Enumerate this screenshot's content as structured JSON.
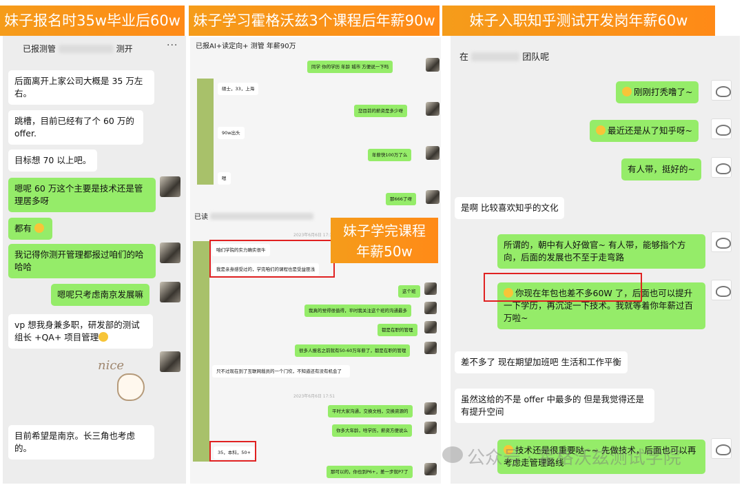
{
  "banners": {
    "left": "妹子报名时35w毕业后60w",
    "middle": "妹子学习霍格沃兹3个课程后年薪90w",
    "right": "妹子入职知乎测试开发岗年薪60w",
    "overlay": "妹子学完课程年薪50w"
  },
  "left_chat": {
    "title_prefix": "已报测管",
    "title_suffix": "测开",
    "menu": "···",
    "messages": [
      "后面离开上家公司大概是 35 万左右。",
      "跳槽，目前已经有了个 60 万的 offer.",
      "目标想 70 以上吧。",
      "嗯呢 60 万这个主要是技术还是管理居多呀",
      "都有",
      "我记得你测开管理都报过咱们的哈哈哈",
      "嗯呢只考虑南京发展嘛",
      "vp 想我身兼多职，研发部的测试组长 +QA+ 项目管理",
      "目前希望是南京。长三角也考虑的。"
    ],
    "sticker": "nice"
  },
  "mid_top_chat": {
    "title": "已报AI+读定向+ 测管 年薪90万",
    "messages": [
      "同学 你的学历  年龄  城市 方便说一下吗",
      "硕士，33，上海",
      "您目前的薪资是多少呀",
      "90w出头",
      "年薪快100万了么",
      "嗯",
      "那666了呀"
    ]
  },
  "mid_bottom_chat": {
    "title_prefix": "已读",
    "time1": "2023年6月6日 17:37",
    "time2": "2023年6月6日 17:51",
    "messages": [
      "咱们学院的实力确实很牛",
      "我是亲身感受过的，学完咱们的课程也是受益匪浅",
      "这个班",
      "我真的觉得很值得，平时我关注这个班的沟通最多",
      "都是在职的管理",
      "很多人报名之前就有50-60万年薪了，都是在职的管理",
      "只不过现在到了互联网裁员的一个门坎，不知道还有没有机会了",
      "平时大家沟通，交换文档，交换资源的",
      "你多大年龄，啥学历，薪资方便说么",
      "35，本科，50+",
      "那可以的，你也到P6+，差一步就P7了"
    ]
  },
  "right_chat": {
    "title_prefix": "在",
    "title_suffix": "团队呢",
    "messages": [
      "刚刚打秃噜了~",
      "最近还是从了知乎呀~",
      "有人带，挺好的~",
      "是啊 比较喜欢知乎的文化",
      "所谓的，朝中有人好做官~ 有人带，能够指个方向，后面的发展也不至于走弯路",
      "你现在年包也差不多60W 了，后面也可以提升一下学历，再沉淀一下技术。我就等着你年薪过百万啦~",
      "差不多了  现在期望加班吧 生活和工作平衡",
      "虽然这给的不是 offer 中最多的 但是我觉得还是有提升空间",
      "技术还是很重要哒~~ 先做技术，后面也可以再考虑走管理路线"
    ]
  },
  "watermark": "公众号 · 霍格沃兹测试学院",
  "colors": {
    "banner": "#f59c1a",
    "green_bubble": "#95ec69",
    "highlight": "#e02020"
  }
}
